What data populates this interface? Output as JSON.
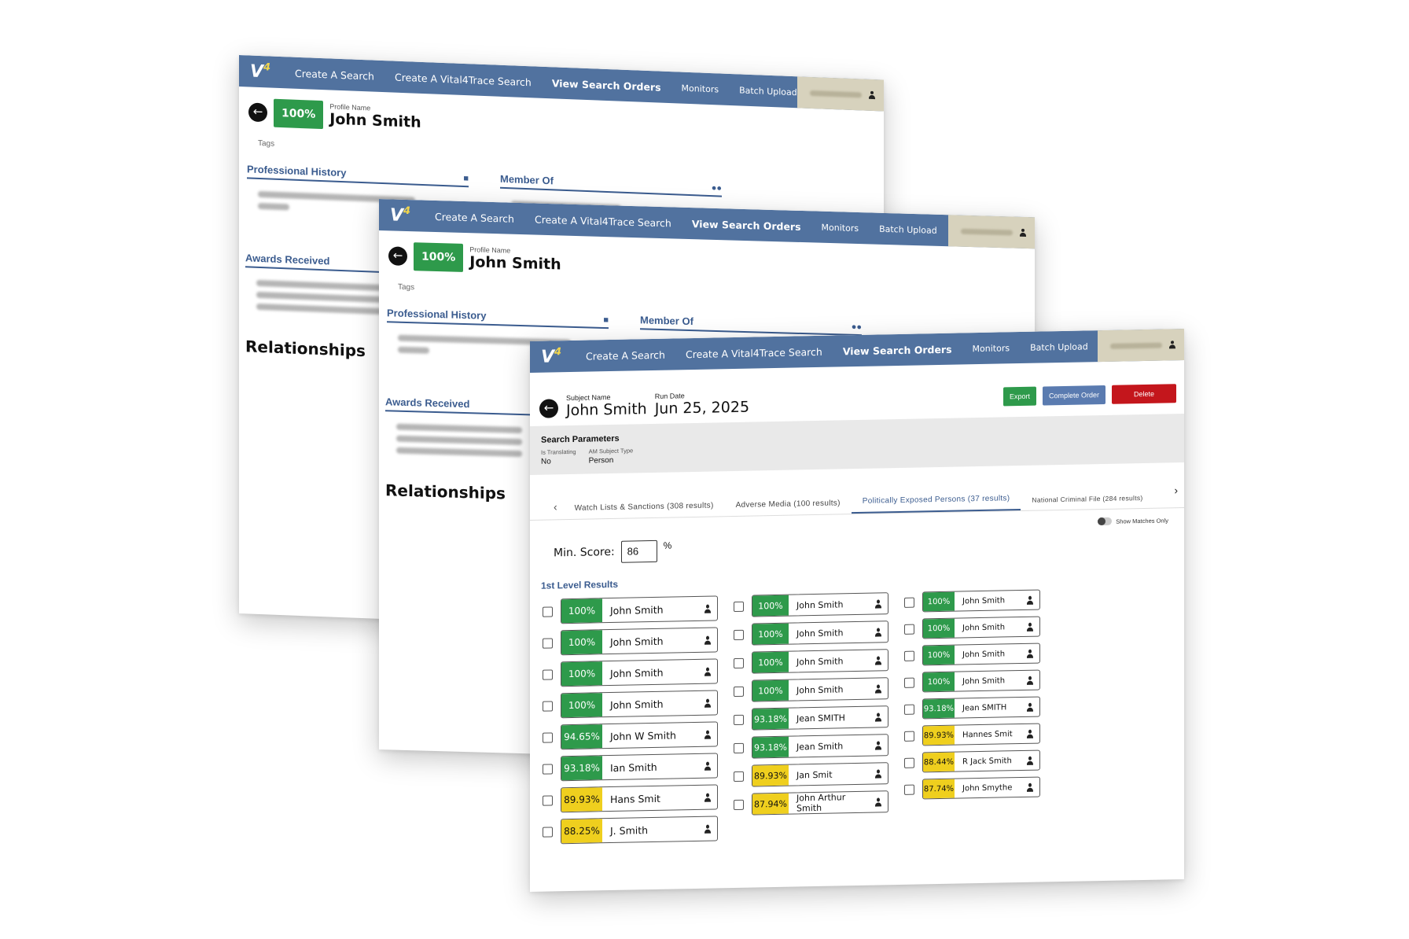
{
  "nav": {
    "logo": "V",
    "logo_sup": "4",
    "items": [
      "Create A Search",
      "Create A Vital4Trace Search",
      "View Search Orders",
      "Monitors",
      "Batch Upload"
    ],
    "active": "View Search Orders"
  },
  "profile": {
    "score": "100%",
    "name_label": "Profile Name",
    "name": "John Smith",
    "tags_label": "Tags",
    "professional_history": "Professional History",
    "member_of": "Member Of",
    "awards_received": "Awards Received",
    "relationships": "Relationships"
  },
  "order": {
    "subject_label": "Subject Name",
    "subject_name": "John Smith",
    "run_date_label": "Run Date",
    "run_date": "Jun 25, 2025",
    "buttons": {
      "export": "Export",
      "complete": "Complete Order",
      "delete": "Delete"
    },
    "params": {
      "title": "Search Parameters",
      "fields": [
        {
          "label": "Is Translating",
          "value": "No"
        },
        {
          "label": "AM Subject Type",
          "value": "Person"
        }
      ]
    },
    "tabs": [
      "Watch Lists & Sanctions (308 results)",
      "Adverse Media (100 results)",
      "Politically Exposed Persons (37 results)",
      "National Criminal File (284 results)"
    ],
    "active_tab": "Politically Exposed Persons (37 results)",
    "show_matches_only": "Show Matches Only",
    "min_score_label": "Min. Score:",
    "min_score_value": "86",
    "min_score_unit": "%",
    "level_title": "1st Level Results",
    "colors": {
      "high": "#2e9a4b",
      "medium": "#efcf1e"
    },
    "results": [
      [
        {
          "score": "100%",
          "name": "John Smith",
          "level": "green"
        },
        {
          "score": "100%",
          "name": "John Smith",
          "level": "green"
        },
        {
          "score": "100%",
          "name": "John Smith",
          "level": "green"
        },
        {
          "score": "100%",
          "name": "John Smith",
          "level": "green"
        },
        {
          "score": "94.65%",
          "name": "John W Smith",
          "level": "green"
        },
        {
          "score": "93.18%",
          "name": "Ian Smith",
          "level": "green"
        },
        {
          "score": "89.93%",
          "name": "Hans Smit",
          "level": "yellow"
        },
        {
          "score": "88.25%",
          "name": "J. Smith",
          "level": "yellow"
        }
      ],
      [
        {
          "score": "100%",
          "name": "John Smith",
          "level": "green"
        },
        {
          "score": "100%",
          "name": "John Smith",
          "level": "green"
        },
        {
          "score": "100%",
          "name": "John Smith",
          "level": "green"
        },
        {
          "score": "100%",
          "name": "John Smith",
          "level": "green"
        },
        {
          "score": "93.18%",
          "name": "Jean SMITH",
          "level": "green"
        },
        {
          "score": "93.18%",
          "name": "Jean Smith",
          "level": "green"
        },
        {
          "score": "89.93%",
          "name": "Jan Smit",
          "level": "yellow"
        },
        {
          "score": "87.94%",
          "name": "John Arthur Smith",
          "level": "yellow"
        }
      ],
      [
        {
          "score": "100%",
          "name": "John Smith",
          "level": "green"
        },
        {
          "score": "100%",
          "name": "John Smith",
          "level": "green"
        },
        {
          "score": "100%",
          "name": "John Smith",
          "level": "green"
        },
        {
          "score": "100%",
          "name": "John Smith",
          "level": "green"
        },
        {
          "score": "93.18%",
          "name": "Jean SMITH",
          "level": "green"
        },
        {
          "score": "89.93%",
          "name": "Hannes Smit",
          "level": "yellow"
        },
        {
          "score": "88.44%",
          "name": "R Jack Smith",
          "level": "yellow"
        },
        {
          "score": "87.74%",
          "name": "John Smythe",
          "level": "yellow"
        }
      ]
    ]
  }
}
